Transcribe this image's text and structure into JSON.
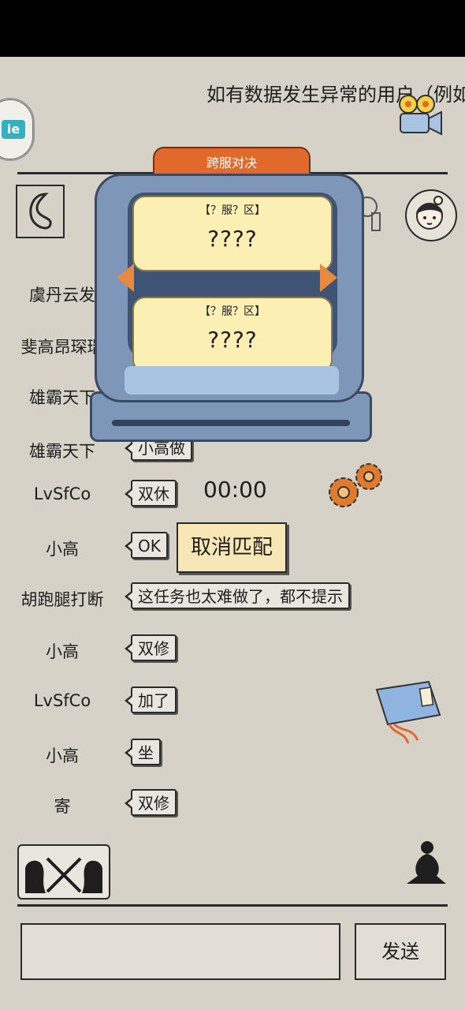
{
  "header": {
    "notice_text": "如有数据发生异常的用户（例如"
  },
  "popup": {
    "title": "跨服对决",
    "slot_top": {
      "server": "【？服？区】",
      "name": "????"
    },
    "slot_bottom": {
      "server": "【？服？区】",
      "name": "????"
    }
  },
  "messages": [
    {
      "name": "虞丹云发",
      "text": ""
    },
    {
      "name": "斐高昂琛瑞",
      "text": ""
    },
    {
      "name": "雄霸天下",
      "text": ""
    },
    {
      "name": "雄霸天下",
      "text": "小高做"
    },
    {
      "name": "LvSfCo",
      "text": "双休"
    },
    {
      "name": "小高",
      "text": "OK"
    },
    {
      "name": "胡跑腿打断",
      "text": "这任务也太难做了，都不提示"
    },
    {
      "name": "小高",
      "text": "双修"
    },
    {
      "name": "LvSfCo",
      "text": "加了"
    },
    {
      "name": "小高",
      "text": "坐"
    },
    {
      "name": "寄",
      "text": "双修"
    }
  ],
  "match": {
    "timer": "00:00",
    "cancel_label": "取消匹配"
  },
  "input": {
    "placeholder": "",
    "send_label": "发送"
  },
  "icons": {
    "camera": "camera-icon",
    "gear": "gear-icon",
    "book": "book-icon",
    "pk": "pk-icon",
    "meditate": "meditate-icon",
    "back": "back-icon"
  },
  "colors": {
    "background": "#d6d2c8",
    "popup_body": "#7e97b8",
    "popup_tab": "#e0692b",
    "card": "#fbefb4",
    "cancel_button": "#f7e6b6"
  }
}
